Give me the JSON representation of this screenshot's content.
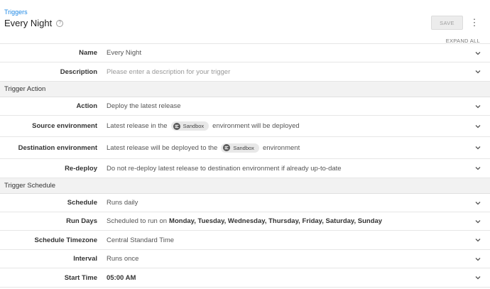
{
  "header": {
    "breadcrumb": "Triggers",
    "title": "Every Night",
    "save_label": "SAVE",
    "expand_all_label": "EXPAND ALL"
  },
  "general": {
    "name_label": "Name",
    "name_value": "Every Night",
    "description_label": "Description",
    "description_placeholder": "Please enter a description for your trigger"
  },
  "trigger_action": {
    "section_title": "Trigger Action",
    "action_label": "Action",
    "action_value": "Deploy the latest release",
    "source_label": "Source environment",
    "source_prefix": "Latest release in the",
    "source_env": "Sandbox",
    "source_suffix": "environment will be deployed",
    "destination_label": "Destination environment",
    "destination_prefix": "Latest release will be deployed to the",
    "destination_env": "Sandbox",
    "destination_suffix": "environment",
    "redeploy_label": "Re-deploy",
    "redeploy_value": "Do not re-deploy latest release to destination environment if already up-to-date"
  },
  "trigger_schedule": {
    "section_title": "Trigger Schedule",
    "schedule_label": "Schedule",
    "schedule_value": "Runs daily",
    "run_days_label": "Run Days",
    "run_days_prefix": "Scheduled to run on",
    "run_days_value": "Monday, Tuesday, Wednesday, Thursday, Friday, Saturday, Sunday",
    "timezone_label": "Schedule Timezone",
    "timezone_value": "Central Standard Time",
    "interval_label": "Interval",
    "interval_value": "Runs once",
    "start_time_label": "Start Time",
    "start_time_value": "05:00 AM"
  }
}
